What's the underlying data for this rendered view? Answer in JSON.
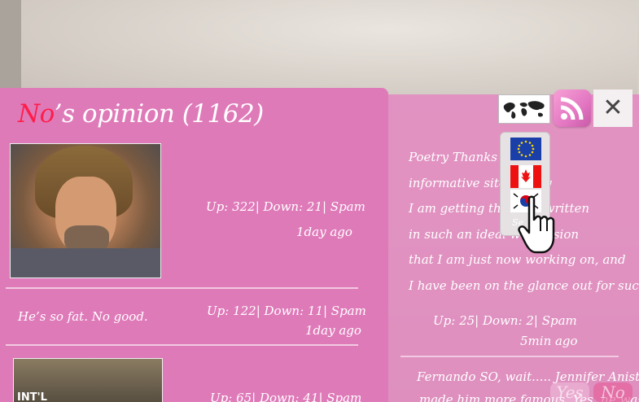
{
  "header": {
    "name": "No",
    "title_rest": "’s opinion (1162)"
  },
  "left_comments": [
    {
      "text": "",
      "votes": "Up: 322| Down: 21| Spam",
      "time": "1day ago"
    },
    {
      "text": "He’s so fat. No good.",
      "votes": "Up: 122| Down: 11| Spam",
      "time": "1day ago"
    },
    {
      "text": "",
      "votes": "Up: 65| Down: 41| Spam",
      "photo_text": "INT'L",
      "time": ""
    }
  ],
  "right_opinion": {
    "lines": [
      "Poetry Thanks for t         er",
      "informative site. T         may",
      "I am getting that k         fo written",
      "in such an ideal wa         mission",
      "that I am just now working on, and",
      "I have been on the glance out for such info."
    ],
    "votes": "Up: 25| Down: 2| Spam",
    "time": "5min ago",
    "next_comment": "Fernando SO, wait..... Jennifer Aniston",
    "next_comment_2": "made him more famous. Yes, he was"
  },
  "toolbar": {
    "world_icon": "world-map-icon",
    "rss_icon": "rss-icon",
    "close_label": "✕"
  },
  "flag_menu": {
    "items": [
      "eu-flag-icon",
      "canada-flag-icon",
      "korea-flag-icon"
    ],
    "select_label": "Se"
  },
  "vote_buttons": {
    "yes": "Yes",
    "no": "No"
  },
  "colors": {
    "panel": "#df7ab9",
    "accent_name": "#ff1d4a"
  }
}
